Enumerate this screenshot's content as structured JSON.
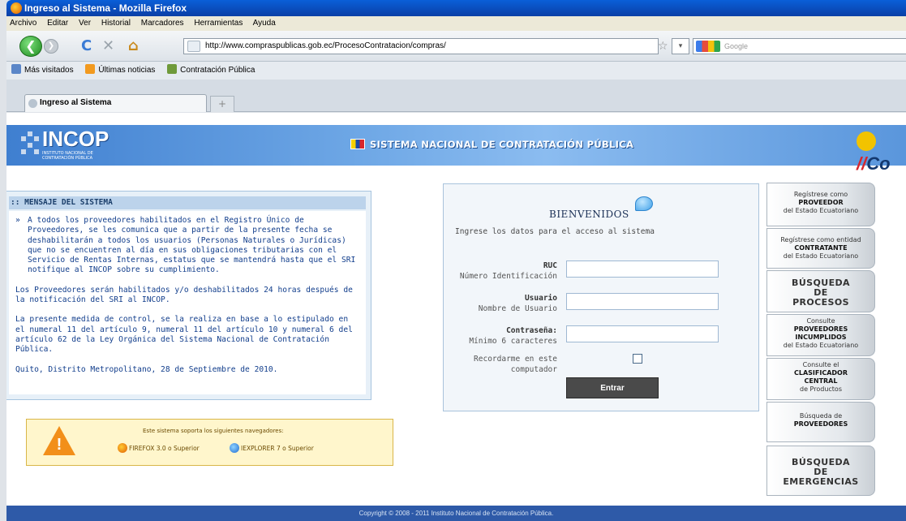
{
  "window": {
    "title": "Ingreso al Sistema - Mozilla Firefox"
  },
  "menu": [
    "Archivo",
    "Editar",
    "Ver",
    "Historial",
    "Marcadores",
    "Herramientas",
    "Ayuda"
  ],
  "nav": {
    "url": "http://www.compraspublicas.gob.ec/ProcesoContratacion/compras/",
    "search_placeholder": "Google",
    "reload_icon": "C",
    "stop_icon": "✕",
    "home_icon": "⌂",
    "back_icon": "❮",
    "fwd_icon": "❯",
    "star_icon": "☆",
    "starbox": "▾"
  },
  "bookmarks": [
    "Más visitados",
    "Últimas noticias",
    "Contratación Pública"
  ],
  "tab": {
    "label": "Ingreso al Sistema",
    "newtab": "+"
  },
  "banner": {
    "logo": "INCOP",
    "logo_sub": "INSTITUTO NACIONAL DE CONTRATACIÓN PÚBLICA",
    "system_title": "SISTEMA NACIONAL DE CONTRATACIÓN PÚBLICA",
    "compras_text": "Co"
  },
  "message": {
    "header": ":: MENSAJE DEL SISTEMA",
    "bullet": "»",
    "paragraphs": [
      "A todos los proveedores habilitados en el Registro Único de Proveedores, se les comunica que a partir de la presente fecha se deshabilitarán a todos los usuarios (Personas Naturales o Jurídicas) que no se encuentren al día en sus obligaciones tributarias con el Servicio de Rentas Internas, estatus que se mantendrá hasta que el SRI notifique al INCOP sobre su cumplimiento.",
      "Los Proveedores serán habilitados y/o deshabilitados 24 horas después de la notificación del SRI al INCOP.",
      "La presente medida de control, se la realiza en base a lo estipulado en el numeral 11 del artículo 9, numeral 11 del artículo 10 y numeral 6 del artículo 62 de la Ley Orgánica del Sistema Nacional de Contratación Pública.",
      "Quito, Distrito Metropolitano, 28 de Septiembre de 2010."
    ]
  },
  "warning": {
    "title": "Este sistema soporta los siguientes navegadores:",
    "browser1": "FIREFOX 3.0 o Superior",
    "browser2": "IEXPLORER 7 o Superior",
    "icon": "!"
  },
  "login": {
    "welcome": "BIENVENIDOS",
    "instructions": "Ingrese los datos para el acceso al sistema",
    "ruc_label": "RUC",
    "ruc_sub": "Número Identificación",
    "user_label": "Usuario",
    "user_sub": "Nombre de Usuario",
    "pass_label": "Contraseña:",
    "pass_sub": "Mínimo 6 caracteres",
    "remember_line1": "Recordarme en este",
    "remember_line2": "computador",
    "submit": "Entrar"
  },
  "sidebar": [
    {
      "l1": "Regístrese como",
      "l2": "PROVEEDOR",
      "l3": "del Estado Ecuatoriano"
    },
    {
      "l1": "Regístrese como entidad",
      "l2": "CONTRATANTE",
      "l3": "del Estado Ecuatoriano"
    },
    {
      "l1": "BÚSQUEDA",
      "l2": "DE",
      "l3": "PROCESOS"
    },
    {
      "l1": "Consulte",
      "l2": "PROVEEDORES",
      "l3": "INCUMPLIDOS",
      "l4": "del Estado Ecuatoriano"
    },
    {
      "l1": "Consulte el",
      "l2": "CLASIFICADOR",
      "l3": "CENTRAL",
      "l4": "de Productos"
    },
    {
      "l1": "Búsqueda de",
      "l2": "PROVEEDORES"
    },
    {
      "l1": "BÚSQUEDA",
      "l2": "DE",
      "l3": "EMERGENCIAS"
    }
  ],
  "footer": "Copyright © 2008 - 2011 Instituto Nacional de Contratación Pública.",
  "colors": {
    "banner": "#5a96dc",
    "footer": "#2e5aa8",
    "title_bar": "#0a5fd8",
    "warning": "#f28f1a"
  }
}
